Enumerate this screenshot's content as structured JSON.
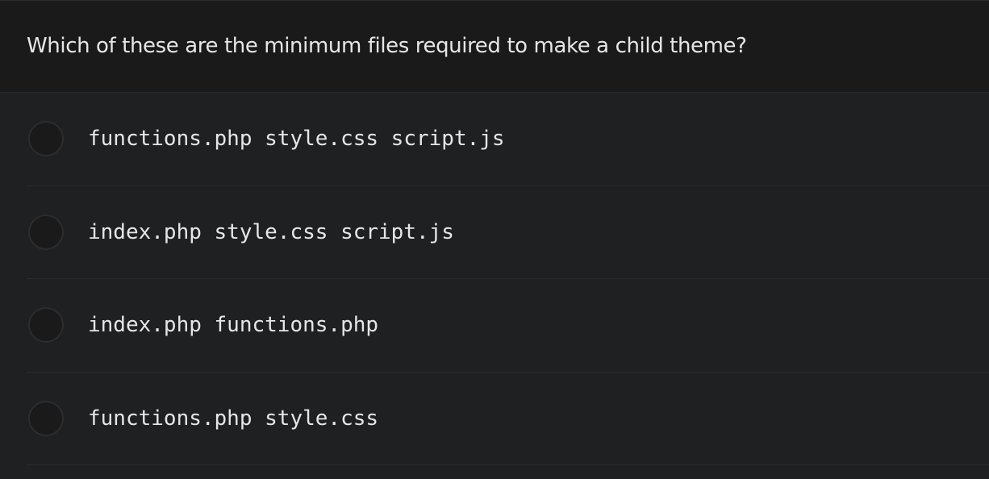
{
  "question": {
    "text": "Which of these are the minimum files required to make a child theme?"
  },
  "options": [
    {
      "label": "functions.php style.css script.js"
    },
    {
      "label": "index.php style.css script.js"
    },
    {
      "label": "index.php functions.php"
    },
    {
      "label": "functions.php style.css"
    }
  ],
  "colors": {
    "background": "#1f2022",
    "header_background": "#1a1a1b",
    "text": "#e6e6e6",
    "divider": "#2b2c2e"
  }
}
